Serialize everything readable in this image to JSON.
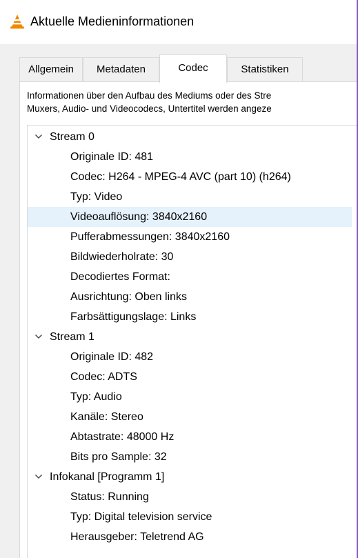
{
  "window": {
    "title": "Aktuelle Medieninformationen"
  },
  "tabs": [
    "Allgemein",
    "Metadaten",
    "Codec",
    "Statistiken"
  ],
  "description": [
    "Informationen über den Aufbau des Mediums oder des Stre",
    "Muxers, Audio- und Videocodecs, Untertitel werden angeze"
  ],
  "tree": [
    {
      "label": "Stream 0",
      "expanded": true,
      "children": [
        "Originale ID: 481",
        "Codec: H264 - MPEG-4 AVC (part 10) (h264)",
        "Typ: Video",
        "Videoauflösung: 3840x2160",
        "Pufferabmessungen: 3840x2160",
        "Bildwiederholrate: 30",
        "Decodiertes Format:",
        "Ausrichtung: Oben links",
        "Farbsättigungslage: Links"
      ]
    },
    {
      "label": "Stream 1",
      "expanded": true,
      "children": [
        "Originale ID: 482",
        "Codec: ADTS",
        "Typ: Audio",
        "Kanäle: Stereo",
        "Abtastrate: 48000 Hz",
        "Bits pro Sample: 32"
      ]
    },
    {
      "label": "Infokanal [Programm 1]",
      "expanded": true,
      "children": [
        "Status: Running",
        "Typ: Digital television service",
        "Herausgeber: Teletrend AG"
      ]
    }
  ],
  "selected_item": "Videoauflösung: 3840x2160",
  "colors": {
    "window_border": "#8a55c9",
    "selection": "#e5f1fb",
    "dialog_background": "#f0f0f0",
    "icon_orange": "#f08a00"
  },
  "icons": {
    "app": "vlc-cone-icon",
    "expand": "chevron-down-icon"
  }
}
